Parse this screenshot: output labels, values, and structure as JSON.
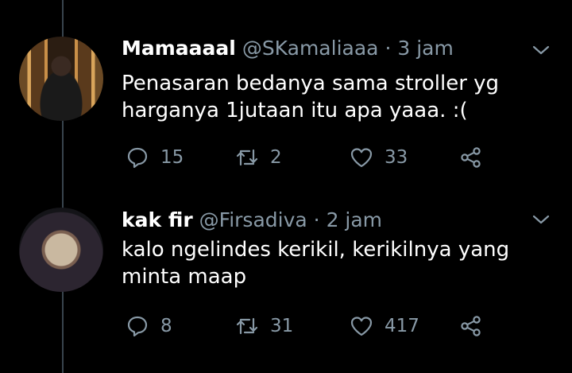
{
  "colors": {
    "background": "#000000",
    "text": "#ffffff",
    "secondary": "#8899a6",
    "thread_line": "#38444d"
  },
  "tweets": [
    {
      "display_name": "Mamaaaal",
      "handle": "@SKamaliaaa",
      "separator": "·",
      "time": "3 jam",
      "text_line1": "Penasaran bedanya sama stroller yg",
      "text_line2": "harganya 1jutaan itu apa yaaa. :(",
      "replies": "15",
      "retweets": "2",
      "likes": "33"
    },
    {
      "display_name": "kak fir",
      "handle": "@Firsadiva",
      "separator": "·",
      "time": "2 jam",
      "text_line1": "kalo ngelindes kerikil, kerikilnya yang",
      "text_line2": "minta maap",
      "replies": "8",
      "retweets": "31",
      "likes": "417"
    }
  ],
  "icons": {
    "reply": "reply-icon",
    "retweet": "retweet-icon",
    "like": "heart-icon",
    "share": "share-icon",
    "menu": "chevron-down-icon"
  }
}
